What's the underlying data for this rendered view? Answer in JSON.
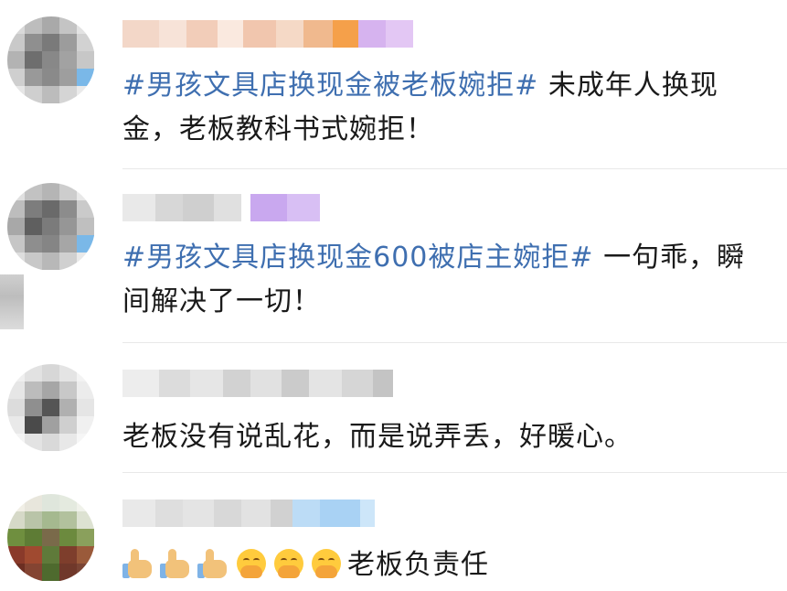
{
  "comments": [
    {
      "topic": "#男孩文具店换现金被老板婉拒#",
      "text": " 未成年人换现金，老板教科书式婉拒！"
    },
    {
      "topic": "#男孩文具店换现金600被店主婉拒#",
      "text": " 一句乖，瞬间解决了一切！"
    },
    {
      "topic": "",
      "text": "老板没有说乱花，而是说弄丢，好暖心。"
    },
    {
      "topic": "",
      "text": "老板负责任",
      "emojis": [
        "thumbs-up-icon",
        "thumbs-up-icon",
        "thumbs-up-icon",
        "covering-mouth-face-icon",
        "covering-mouth-face-icon",
        "covering-mouth-face-icon"
      ]
    }
  ],
  "colors": {
    "topic_link": "#3f6fb0",
    "body_text": "#1a1a1a",
    "divider": "#e8e8e8"
  }
}
